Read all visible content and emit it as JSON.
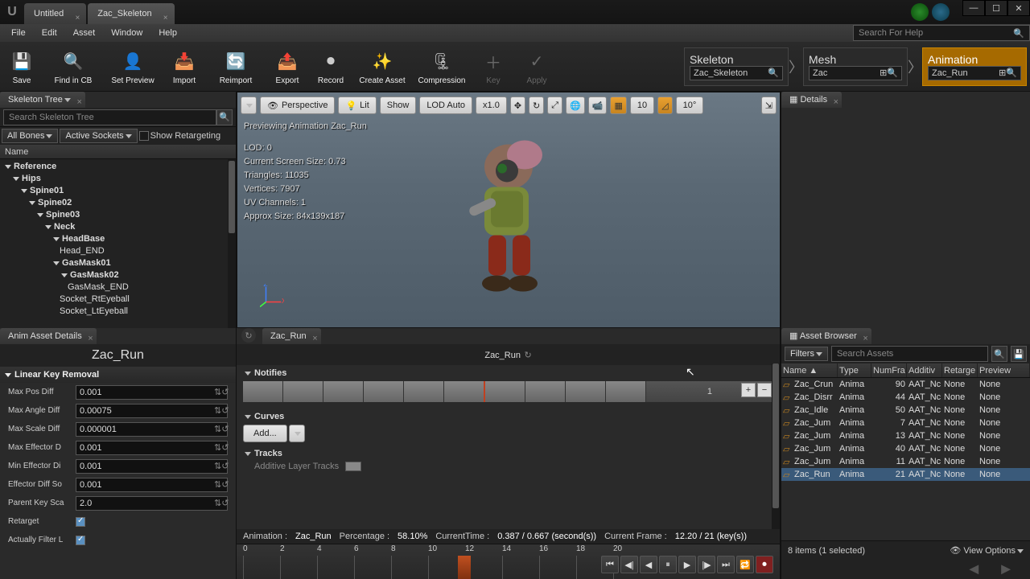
{
  "tabs": [
    {
      "label": "Untitled"
    },
    {
      "label": "Zac_Skeleton"
    }
  ],
  "menu": [
    "File",
    "Edit",
    "Asset",
    "Window",
    "Help"
  ],
  "help_search_placeholder": "Search For Help",
  "toolbar": [
    {
      "label": "Save",
      "glyph": "💾"
    },
    {
      "label": "Find in CB",
      "glyph": "🔍"
    },
    {
      "label": "Set Preview",
      "glyph": "👤"
    },
    {
      "label": "Import",
      "glyph": "📥"
    },
    {
      "label": "Reimport",
      "glyph": "🔄"
    },
    {
      "label": "Export",
      "glyph": "📤"
    },
    {
      "label": "Record",
      "glyph": "⏺"
    },
    {
      "label": "Create Asset",
      "glyph": "✨"
    },
    {
      "label": "Compression",
      "glyph": "🗜"
    },
    {
      "label": "Key",
      "glyph": "＋",
      "dim": true
    },
    {
      "label": "Apply",
      "glyph": "✓",
      "dim": true
    }
  ],
  "persona": {
    "skeleton": {
      "title": "Skeleton",
      "value": "Zac_Skeleton"
    },
    "mesh": {
      "title": "Mesh",
      "value": "Zac"
    },
    "animation": {
      "title": "Animation",
      "value": "Zac_Run"
    }
  },
  "skeleton_panel": {
    "title": "Skeleton Tree",
    "search_placeholder": "Search Skeleton Tree",
    "all_bones": "All Bones",
    "active_sockets": "Active Sockets",
    "show_retarget": "Show Retargeting",
    "header": "Name",
    "bones": [
      {
        "label": "Reference",
        "indent": 0,
        "bold": true,
        "ref": true
      },
      {
        "label": "Hips",
        "indent": 1,
        "bold": true
      },
      {
        "label": "Spine01",
        "indent": 2,
        "bold": true
      },
      {
        "label": "Spine02",
        "indent": 3,
        "bold": true
      },
      {
        "label": "Spine03",
        "indent": 4,
        "bold": true
      },
      {
        "label": "Neck",
        "indent": 5,
        "bold": true
      },
      {
        "label": "HeadBase",
        "indent": 6,
        "bold": true
      },
      {
        "label": "Head_END",
        "indent": 7
      },
      {
        "label": "GasMask01",
        "indent": 6,
        "bold": true
      },
      {
        "label": "GasMask02",
        "indent": 7,
        "bold": true
      },
      {
        "label": "GasMask_END",
        "indent": 8
      },
      {
        "label": "Socket_RtEyeball",
        "indent": 7
      },
      {
        "label": "Socket_LtEyeball",
        "indent": 7
      }
    ]
  },
  "viewport": {
    "perspective": "Perspective",
    "lit": "Lit",
    "show": "Show",
    "lod": "LOD Auto",
    "speed": "x1.0",
    "grid": "10",
    "angle": "10°",
    "preview_text": "Previewing Animation Zac_Run",
    "stats": [
      "LOD: 0",
      "Current Screen Size: 0.73",
      "Triangles: 11035",
      "Vertices: 7907",
      "UV Channels: 1",
      "Approx Size: 84x139x187"
    ]
  },
  "details_title": "Details",
  "anim_details": {
    "tab": "Anim Asset Details",
    "title": "Zac_Run",
    "section": "Linear Key Removal",
    "props": [
      {
        "label": "Max Pos Diff",
        "value": "0.001"
      },
      {
        "label": "Max Angle Diff",
        "value": "0.00075"
      },
      {
        "label": "Max Scale Diff",
        "value": "0.000001"
      },
      {
        "label": "Max Effector D",
        "value": "0.001"
      },
      {
        "label": "Min Effector Di",
        "value": "0.001"
      },
      {
        "label": "Effector Diff So",
        "value": "0.001"
      },
      {
        "label": "Parent Key Sca",
        "value": "2.0"
      }
    ],
    "checks": [
      {
        "label": "Retarget",
        "checked": true
      },
      {
        "label": "Actually Filter L",
        "checked": true
      }
    ]
  },
  "timeline": {
    "tab": "Zac_Run",
    "title": "Zac_Run",
    "notifies": "Notifies",
    "notify_label": "1",
    "curves": "Curves",
    "add": "Add...",
    "tracks": "Tracks",
    "additive": "Additive Layer Tracks",
    "info": {
      "anim": "Animation :",
      "anim_v": "Zac_Run",
      "pct": "Percentage :",
      "pct_v": "58.10%",
      "ct": "CurrentTime :",
      "ct_v": "0.387 / 0.667 (second(s))",
      "cf": "Current Frame :",
      "cf_v": "12.20 / 21 (key(s))"
    },
    "ticks": [
      "0",
      "2",
      "4",
      "6",
      "8",
      "10",
      "12",
      "14",
      "16",
      "18",
      "20"
    ]
  },
  "browser": {
    "tab": "Asset Browser",
    "filters": "Filters",
    "search_placeholder": "Search Assets",
    "cols": [
      "Name",
      "Type",
      "NumFra",
      "Additiv",
      "Retarge",
      "Preview"
    ],
    "rows": [
      {
        "n": "Zac_Crun",
        "t": "Anima",
        "f": "90",
        "a": "AAT_Nc",
        "r": "None",
        "p": "None"
      },
      {
        "n": "Zac_Disrr",
        "t": "Anima",
        "f": "44",
        "a": "AAT_Nc",
        "r": "None",
        "p": "None"
      },
      {
        "n": "Zac_Idle",
        "t": "Anima",
        "f": "50",
        "a": "AAT_Nc",
        "r": "None",
        "p": "None"
      },
      {
        "n": "Zac_Jum",
        "t": "Anima",
        "f": "7",
        "a": "AAT_Nc",
        "r": "None",
        "p": "None"
      },
      {
        "n": "Zac_Jum",
        "t": "Anima",
        "f": "13",
        "a": "AAT_Nc",
        "r": "None",
        "p": "None"
      },
      {
        "n": "Zac_Jum",
        "t": "Anima",
        "f": "40",
        "a": "AAT_Nc",
        "r": "None",
        "p": "None"
      },
      {
        "n": "Zac_Jum",
        "t": "Anima",
        "f": "11",
        "a": "AAT_Nc",
        "r": "None",
        "p": "None"
      },
      {
        "n": "Zac_Run",
        "t": "Anima",
        "f": "21",
        "a": "AAT_Nc",
        "r": "None",
        "p": "None",
        "sel": true
      }
    ],
    "footer": "8 items (1 selected)",
    "view_options": "View Options"
  }
}
